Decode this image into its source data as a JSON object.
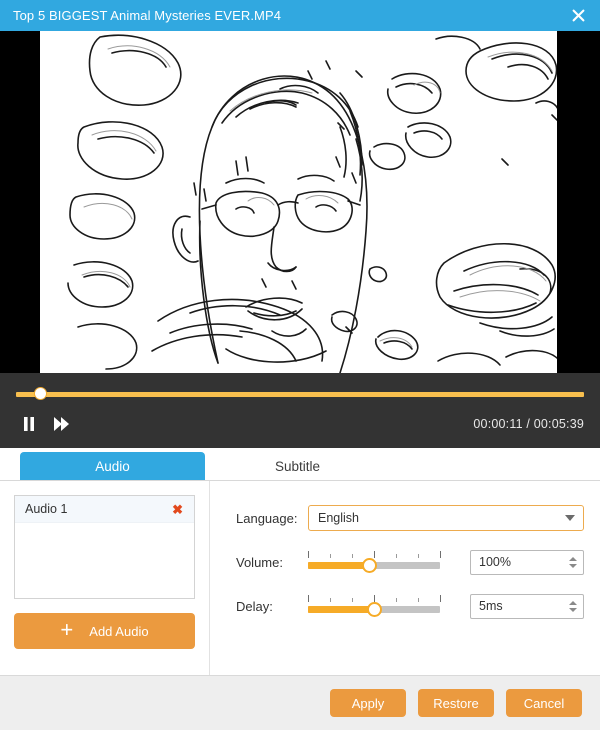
{
  "window": {
    "title": "Top 5 BIGGEST Animal Mysteries EVER.MP4",
    "close_label": "✕",
    "accent_blue": "#31a8e0",
    "accent_orange": "#eb9a3f"
  },
  "player": {
    "pause_icon": "pause-icon",
    "forward_icon": "fast-forward-icon",
    "current_time": "00:00:11",
    "separator": "/",
    "total_time": "00:05:39",
    "time_display": "00:00:11 / 00:05:39",
    "progress_percent": 4.2
  },
  "tabs": [
    {
      "label": "Audio",
      "active": true
    },
    {
      "label": "Subtitle",
      "active": false
    }
  ],
  "audio_panel": {
    "tracks": [
      {
        "name": "Audio 1",
        "remove_icon": "✖"
      }
    ],
    "add_button": {
      "label": "Add Audio",
      "plus_glyph": "+"
    }
  },
  "settings": {
    "language": {
      "label": "Language:",
      "value": "English"
    },
    "volume": {
      "label": "Volume:",
      "value": "100%",
      "slider_percent": 46
    },
    "delay": {
      "label": "Delay:",
      "value": "5ms",
      "slider_percent": 50
    }
  },
  "footer": {
    "apply_label": "Apply",
    "restore_label": "Restore",
    "cancel_label": "Cancel"
  }
}
